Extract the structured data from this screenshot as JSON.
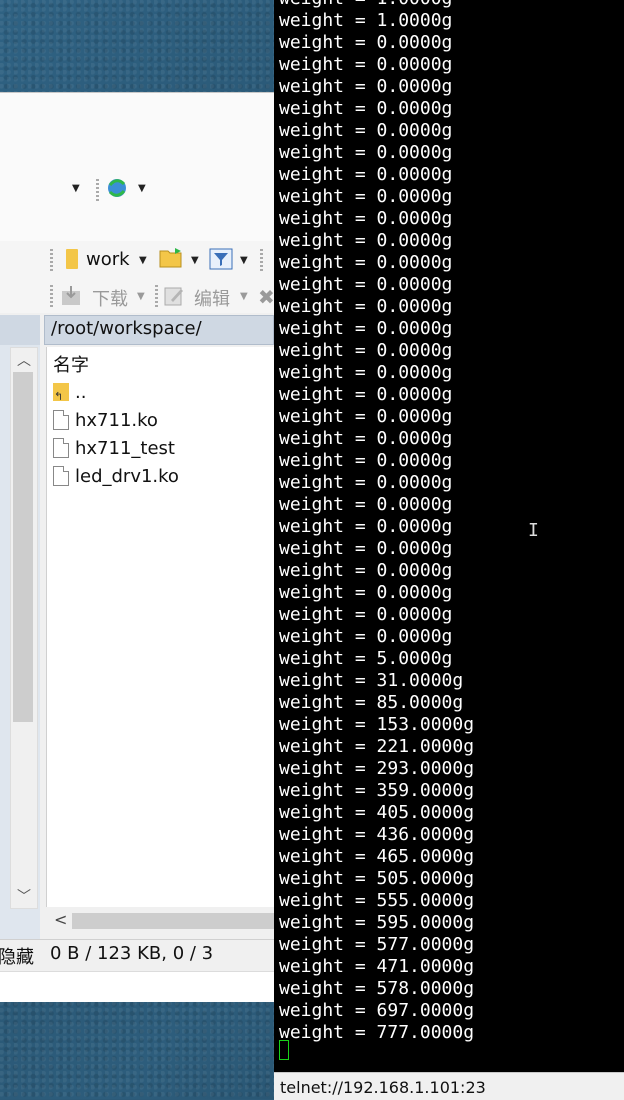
{
  "file_manager": {
    "toolbar": {
      "work_label": "work",
      "download_label": "下载",
      "edit_label": "编辑"
    },
    "path": "/root/workspace/",
    "column_header": "名字",
    "files": [
      {
        "name": "..",
        "icon": "parent-folder-icon"
      },
      {
        "name": "hx711.ko",
        "icon": "file-icon"
      },
      {
        "name": "hx711_test",
        "icon": "file-icon"
      },
      {
        "name": "led_drv1.ko",
        "icon": "file-icon"
      }
    ],
    "status": {
      "hidden_label": "隐藏",
      "info": "0 B / 123 KB,  0 / 3"
    }
  },
  "terminal": {
    "lines": [
      "weight = 1.0000g",
      "weight = 1.0000g",
      "weight = 0.0000g",
      "weight = 0.0000g",
      "weight = 0.0000g",
      "weight = 0.0000g",
      "weight = 0.0000g",
      "weight = 0.0000g",
      "weight = 0.0000g",
      "weight = 0.0000g",
      "weight = 0.0000g",
      "weight = 0.0000g",
      "weight = 0.0000g",
      "weight = 0.0000g",
      "weight = 0.0000g",
      "weight = 0.0000g",
      "weight = 0.0000g",
      "weight = 0.0000g",
      "weight = 0.0000g",
      "weight = 0.0000g",
      "weight = 0.0000g",
      "weight = 0.0000g",
      "weight = 0.0000g",
      "weight = 0.0000g",
      "weight = 0.0000g",
      "weight = 0.0000g",
      "weight = 0.0000g",
      "weight = 0.0000g",
      "weight = 0.0000g",
      "weight = 0.0000g",
      "weight = 5.0000g",
      "weight = 31.0000g",
      "weight = 85.0000g",
      "weight = 153.0000g",
      "weight = 221.0000g",
      "weight = 293.0000g",
      "weight = 359.0000g",
      "weight = 405.0000g",
      "weight = 436.0000g",
      "weight = 465.0000g",
      "weight = 505.0000g",
      "weight = 555.0000g",
      "weight = 595.0000g",
      "weight = 577.0000g",
      "weight = 471.0000g",
      "weight = 578.0000g",
      "weight = 697.0000g",
      "weight = 777.0000g"
    ],
    "status_bar": "telnet://192.168.1.101:23",
    "cursor_color": "#19d219"
  }
}
